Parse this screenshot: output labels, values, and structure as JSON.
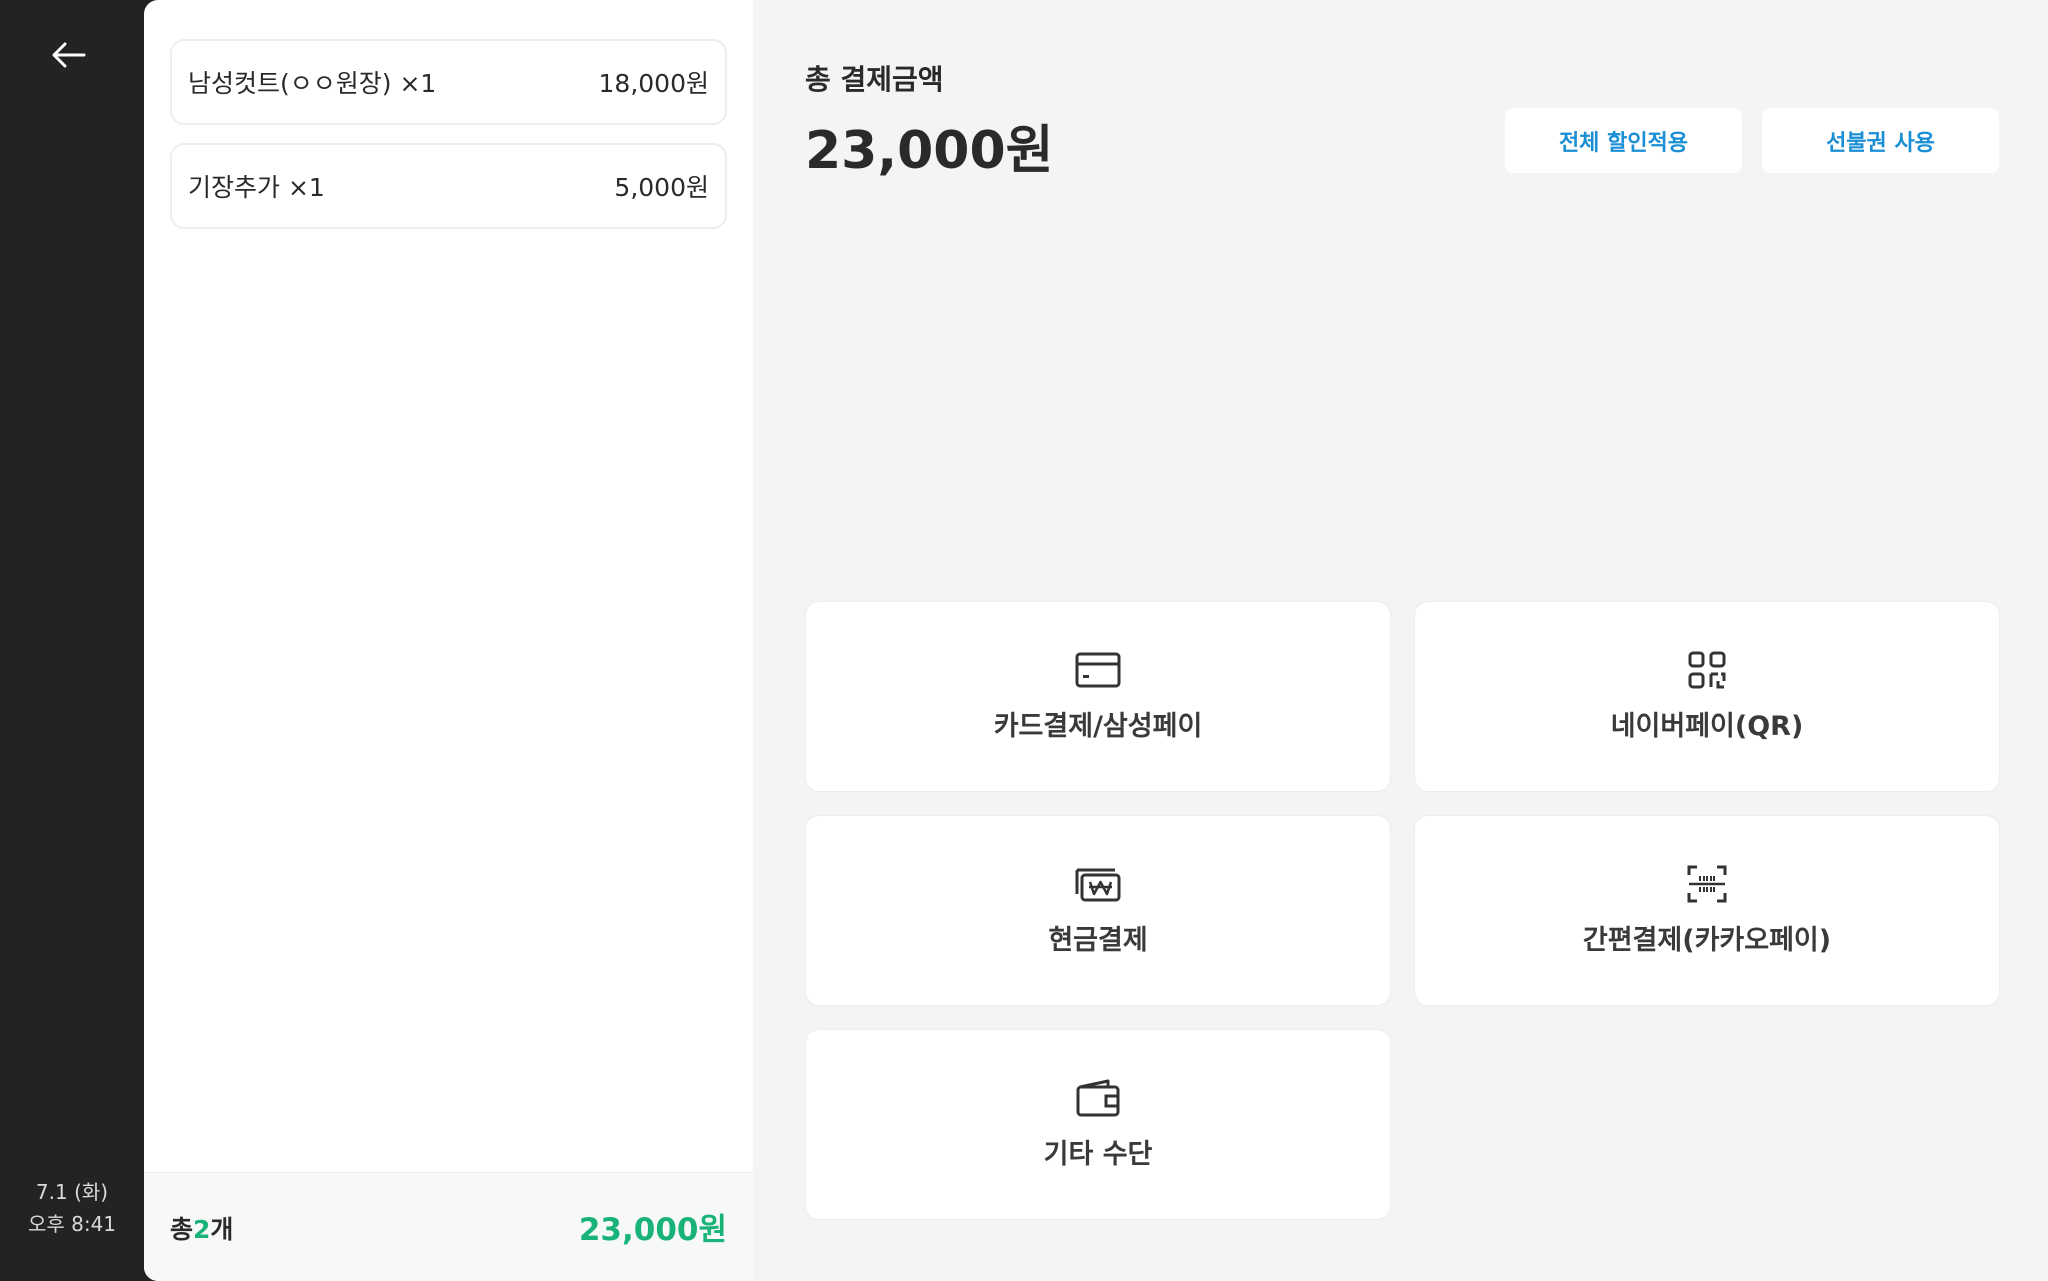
{
  "order": {
    "items": [
      {
        "name": "남성컷트(ㅇㅇ원장) ×1",
        "price": "18,000원"
      },
      {
        "name": "기장추가 ×1",
        "price": "5,000원"
      }
    ],
    "count_prefix": "총",
    "count_value": "2",
    "count_suffix": "개",
    "total": "23,000원"
  },
  "rail": {
    "date": "7.1 (화)",
    "time": "오후 8:41"
  },
  "payment": {
    "total_label": "총 결제금액",
    "total_amount": "23,000원",
    "discount_button": "전체 할인적용",
    "prepaid_button": "선불권 사용",
    "methods": [
      {
        "label": "카드결제/삼성페이",
        "icon": "credit-card-icon"
      },
      {
        "label": "네이버페이(QR)",
        "icon": "qr-code-icon"
      },
      {
        "label": "현금결제",
        "icon": "cash-won-icon"
      },
      {
        "label": "간편결제(카카오페이)",
        "icon": "barcode-scan-icon"
      },
      {
        "label": "기타 수단",
        "icon": "wallet-icon"
      }
    ]
  },
  "colors": {
    "accent_green": "#19b37a",
    "accent_blue": "#1b8fd6",
    "rail_bg": "#232323"
  }
}
